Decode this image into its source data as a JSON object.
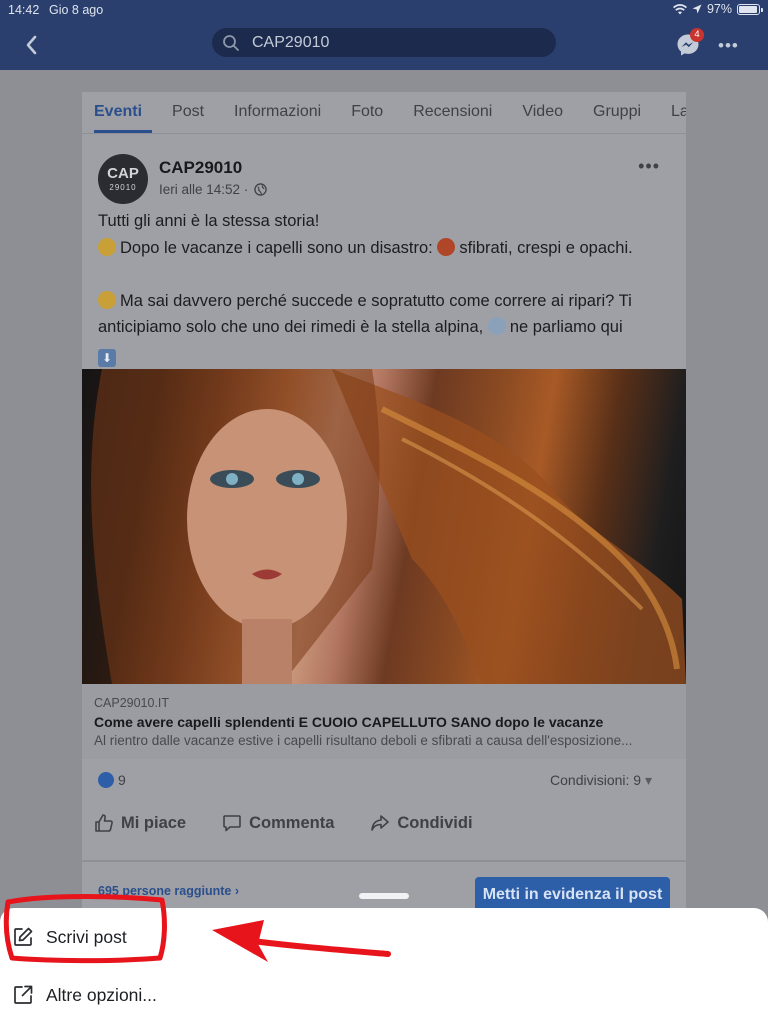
{
  "status_bar": {
    "time": "14:42",
    "date": "Gio 8 ago",
    "battery": "97%",
    "battery_level": 0.97
  },
  "nav": {
    "search_value": "CAP29010",
    "messenger_badge": "4"
  },
  "tabs": [
    "Eventi",
    "Post",
    "Informazioni",
    "Foto",
    "Recensioni",
    "Video",
    "Gruppi",
    "Lavo"
  ],
  "post": {
    "avatar_line1": "CAP",
    "avatar_line2": "29010",
    "page_name": "CAP29010",
    "time": "Ieri alle 14:52 ·",
    "line1": "Tutti gli anni è la stessa storia!",
    "line2a": "Dopo le vacanze i capelli sono un disastro:",
    "line2b": "sfibrati, crespi e opachi.",
    "line3": "Ma sai davvero perché succede e sopratutto come correre ai ripari? Ti anticipiamo solo che uno dei rimedi è la stella alpina,",
    "line3b": "ne parliamo qui"
  },
  "link": {
    "domain": "CAP29010.IT",
    "title": "Come avere capelli splendenti E CUOIO CAPELLUTO SANO dopo le vacanze",
    "description": "Al rientro dalle vacanze estive i capelli risultano deboli e sfibrati a causa dell'esposizione..."
  },
  "reactions": {
    "likes": "9",
    "shares": "Condivisioni: 9"
  },
  "actions": {
    "like": "Mi piace",
    "comment": "Commenta",
    "share": "Condividi"
  },
  "reach": "695 persone raggiunte",
  "boost_label": "Metti in evidenza il post",
  "sheet": {
    "write_post": "Scrivi post",
    "more_options": "Altre opzioni..."
  },
  "colors": {
    "nav_bg": "#2a3f6d",
    "accent": "#2d5ea8",
    "annotation": "#e8141c"
  }
}
